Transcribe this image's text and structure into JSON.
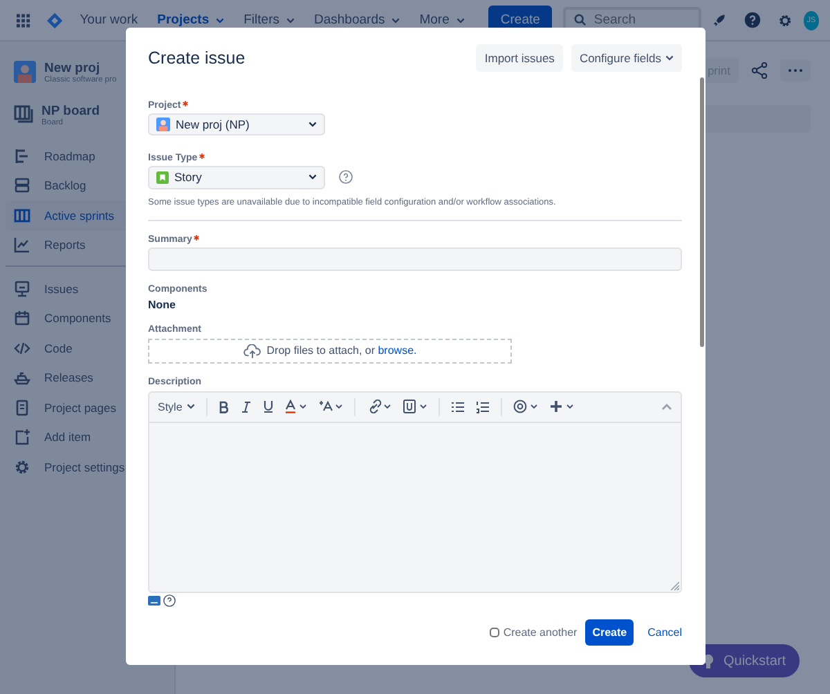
{
  "nav": {
    "items": [
      {
        "label": "Your work",
        "selected": false,
        "dropdown": false
      },
      {
        "label": "Projects",
        "selected": true,
        "dropdown": true
      },
      {
        "label": "Filters",
        "selected": false,
        "dropdown": true
      },
      {
        "label": "Dashboards",
        "selected": false,
        "dropdown": true
      },
      {
        "label": "More",
        "selected": false,
        "dropdown": true
      }
    ],
    "create": "Create",
    "search": {
      "placeholder": "Search"
    },
    "avatar": "JS"
  },
  "sidebar": {
    "project": {
      "name": "New proj",
      "type": "Classic software pro"
    },
    "board": {
      "name": "NP board",
      "type": "Board"
    },
    "planning": [
      {
        "label": "Roadmap",
        "selected": false
      },
      {
        "label": "Backlog",
        "selected": false
      },
      {
        "label": "Active sprints",
        "selected": true
      },
      {
        "label": "Reports",
        "selected": false
      }
    ],
    "development": [
      {
        "label": "Issues",
        "selected": false
      },
      {
        "label": "Components",
        "selected": false
      },
      {
        "label": "Code",
        "selected": false
      },
      {
        "label": "Releases",
        "selected": false
      },
      {
        "label": "Project pages",
        "selected": false
      },
      {
        "label": "Add item",
        "selected": false
      },
      {
        "label": "Project settings",
        "selected": false
      }
    ]
  },
  "page": {
    "sprint_button": "print"
  },
  "quickstart": "Quickstart",
  "modal": {
    "title": "Create issue",
    "actions": [
      "Import issues",
      "Configure fields"
    ],
    "project": {
      "label": "Project",
      "required": true,
      "value": "New proj (NP)"
    },
    "issue_type": {
      "label": "Issue Type",
      "required": true,
      "value": "Story",
      "note": "Some issue types are unavailable due to incompatible field configuration and/or workflow associations."
    },
    "summary": {
      "label": "Summary",
      "required": true
    },
    "components": {
      "label": "Components",
      "value": "None"
    },
    "attachment": {
      "label": "Attachment",
      "text": "Drop files to attach, or",
      "link": "browse."
    },
    "description": {
      "label": "Description",
      "style": "Style"
    },
    "create_another": {
      "label": "Create another",
      "checked": false
    },
    "submit": "Create",
    "cancel": "Cancel"
  }
}
